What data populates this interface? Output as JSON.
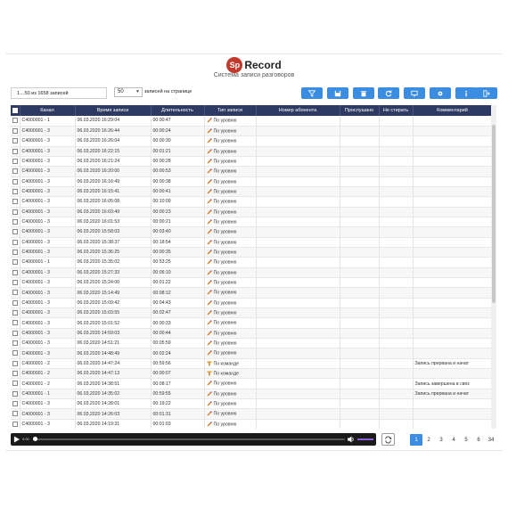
{
  "app": {
    "logo_badge": "Sp",
    "logo_text": "Record",
    "subtitle": "Система записи разговоров",
    "brand_color": "#c0392b",
    "accent_color": "#3a8de0",
    "header_color": "#2e3a62"
  },
  "toolbar": {
    "records_info": "1…50 из 1658 записей",
    "per_page_value": "50",
    "per_page_label": "записей на странице",
    "buttons": [
      {
        "icon": "filter-icon"
      },
      {
        "icon": "save-icon"
      },
      {
        "icon": "trash-icon"
      },
      {
        "icon": "refresh-icon"
      },
      {
        "icon": "monitor-icon"
      },
      {
        "icon": "gear-icon"
      },
      {
        "icon": "info-icon"
      },
      {
        "icon": "logout-icon"
      }
    ]
  },
  "table": {
    "columns": [
      "Канал",
      "Время записи",
      "Длительность",
      "Тип записи",
      "Номер абонента",
      "Прослушано",
      "Не стирать",
      "Комментарий"
    ],
    "rows": [
      {
        "channel": "C4000001 - 1",
        "time": "06.03.2020 16:29:04",
        "duration": "00:00:47",
        "type": "По уровню",
        "kind": "level",
        "comment": ""
      },
      {
        "channel": "C4000001 - 3",
        "time": "06.03.2020 16:26:44",
        "duration": "00:00:24",
        "type": "По уровню",
        "kind": "level",
        "comment": ""
      },
      {
        "channel": "C4000001 - 3",
        "time": "06.03.2020 16:26:04",
        "duration": "00:00:30",
        "type": "По уровню",
        "kind": "level",
        "comment": ""
      },
      {
        "channel": "C4000001 - 3",
        "time": "06.03.2020 16:22:15",
        "duration": "00:01:21",
        "type": "По уровню",
        "kind": "level",
        "comment": ""
      },
      {
        "channel": "C4000001 - 3",
        "time": "06.03.2020 16:21:24",
        "duration": "00:00:28",
        "type": "По уровню",
        "kind": "level",
        "comment": ""
      },
      {
        "channel": "C4000001 - 3",
        "time": "06.03.2020 16:20:00",
        "duration": "00:00:53",
        "type": "По уровню",
        "kind": "level",
        "comment": ""
      },
      {
        "channel": "C4000001 - 3",
        "time": "06.03.2020 16:16:49",
        "duration": "00:00:38",
        "type": "По уровню",
        "kind": "level",
        "comment": ""
      },
      {
        "channel": "C4000001 - 3",
        "time": "06.03.2020 16:15:41",
        "duration": "00:00:41",
        "type": "По уровню",
        "kind": "level",
        "comment": ""
      },
      {
        "channel": "C4000001 - 3",
        "time": "06.03.2020 16:05:08",
        "duration": "00:10:09",
        "type": "По уровню",
        "kind": "level",
        "comment": ""
      },
      {
        "channel": "C4000001 - 3",
        "time": "06.03.2020 16:03:49",
        "duration": "00:00:23",
        "type": "По уровню",
        "kind": "level",
        "comment": ""
      },
      {
        "channel": "C4000001 - 3",
        "time": "06.03.2020 16:01:53",
        "duration": "00:00:21",
        "type": "По уровню",
        "kind": "level",
        "comment": ""
      },
      {
        "channel": "C4000001 - 3",
        "time": "06.03.2020 15:58:03",
        "duration": "00:03:40",
        "type": "По уровню",
        "kind": "level",
        "comment": ""
      },
      {
        "channel": "C4000001 - 3",
        "time": "06.03.2020 15:38:37",
        "duration": "00:18:54",
        "type": "По уровню",
        "kind": "level",
        "comment": ""
      },
      {
        "channel": "C4000001 - 3",
        "time": "06.03.2020 15:36:25",
        "duration": "00:00:35",
        "type": "По уровню",
        "kind": "level",
        "comment": ""
      },
      {
        "channel": "C4000001 - 1",
        "time": "06.03.2020 15:35:02",
        "duration": "00:53:25",
        "type": "По уровню",
        "kind": "level",
        "comment": ""
      },
      {
        "channel": "C4000001 - 3",
        "time": "06.03.2020 15:27:33",
        "duration": "00:06:10",
        "type": "По уровню",
        "kind": "level",
        "comment": ""
      },
      {
        "channel": "C4000001 - 3",
        "time": "06.03.2020 15:24:00",
        "duration": "00:01:22",
        "type": "По уровню",
        "kind": "level",
        "comment": ""
      },
      {
        "channel": "C4000001 - 3",
        "time": "06.03.2020 15:14:49",
        "duration": "00:08:12",
        "type": "По уровню",
        "kind": "level",
        "comment": ""
      },
      {
        "channel": "C4000001 - 3",
        "time": "06.03.2020 15:09:42",
        "duration": "00:04:43",
        "type": "По уровню",
        "kind": "level",
        "comment": ""
      },
      {
        "channel": "C4000001 - 3",
        "time": "06.03.2020 15:03:55",
        "duration": "00:02:47",
        "type": "По уровню",
        "kind": "level",
        "comment": ""
      },
      {
        "channel": "C4000001 - 3",
        "time": "06.03.2020 15:01:52",
        "duration": "00:00:33",
        "type": "По уровню",
        "kind": "level",
        "comment": ""
      },
      {
        "channel": "C4000001 - 3",
        "time": "06.03.2020 14:59:03",
        "duration": "00:00:44",
        "type": "По уровню",
        "kind": "level",
        "comment": ""
      },
      {
        "channel": "C4000001 - 3",
        "time": "06.03.2020 14:51:21",
        "duration": "00:05:59",
        "type": "По уровню",
        "kind": "level",
        "comment": ""
      },
      {
        "channel": "C4000001 - 3",
        "time": "06.03.2020 14:48:49",
        "duration": "00:02:24",
        "type": "По уровню",
        "kind": "level",
        "comment": ""
      },
      {
        "channel": "C4000001 - 2",
        "time": "06.03.2020 14:47:24",
        "duration": "00:59:56",
        "type": "По команде",
        "kind": "command",
        "comment": "Запись прервана и начат"
      },
      {
        "channel": "C4000001 - 2",
        "time": "06.03.2020 14:47:13",
        "duration": "00:00:07",
        "type": "По команде",
        "kind": "command",
        "comment": ""
      },
      {
        "channel": "C4000001 - 2",
        "time": "06.03.2020 14:38:51",
        "duration": "00:08:17",
        "type": "По уровню",
        "kind": "level",
        "comment": "Запись завершена в связ"
      },
      {
        "channel": "C4000001 - 1",
        "time": "06.03.2020 14:35:02",
        "duration": "00:59:55",
        "type": "По уровню",
        "kind": "level",
        "comment": "Запись прервана и начат"
      },
      {
        "channel": "C4000001 - 3",
        "time": "06.03.2020 14:28:01",
        "duration": "00:19:22",
        "type": "По уровню",
        "kind": "level",
        "comment": ""
      },
      {
        "channel": "C4000001 - 3",
        "time": "06.03.2020 14:26:03",
        "duration": "00:01:31",
        "type": "По уровню",
        "kind": "level",
        "comment": ""
      },
      {
        "channel": "C4000001 - 3",
        "time": "06.03.2020 14:19:31",
        "duration": "00:01:03",
        "type": "По уровню",
        "kind": "level",
        "comment": ""
      }
    ]
  },
  "player": {
    "time": "0:00",
    "progress": 0
  },
  "pager": {
    "pages": [
      "1",
      "2",
      "3",
      "4",
      "5",
      "6",
      "34"
    ],
    "active": "1"
  }
}
